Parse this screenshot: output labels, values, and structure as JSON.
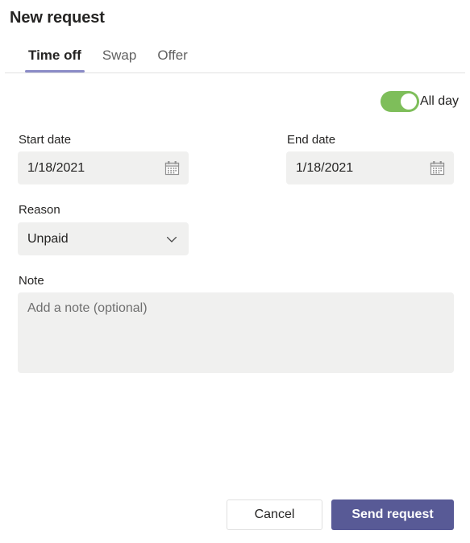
{
  "header": {
    "title": "New request"
  },
  "tabs": [
    {
      "label": "Time off",
      "active": true
    },
    {
      "label": "Swap",
      "active": false
    },
    {
      "label": "Offer",
      "active": false
    }
  ],
  "allday": {
    "label": "All day",
    "state": "on",
    "color": "#7ebe5a"
  },
  "form": {
    "start_date": {
      "label": "Start date",
      "value": "1/18/2021",
      "icon": "calendar-icon"
    },
    "end_date": {
      "label": "End date",
      "value": "1/18/2021",
      "icon": "calendar-icon"
    },
    "reason": {
      "label": "Reason",
      "value": "Unpaid",
      "icon": "chevron-down-icon",
      "options": [
        "Unpaid"
      ]
    },
    "note": {
      "label": "Note",
      "value": "",
      "placeholder": "Add a note (optional)"
    }
  },
  "footer": {
    "cancel_label": "Cancel",
    "send_label": "Send request",
    "accent_color": "#585a96"
  }
}
